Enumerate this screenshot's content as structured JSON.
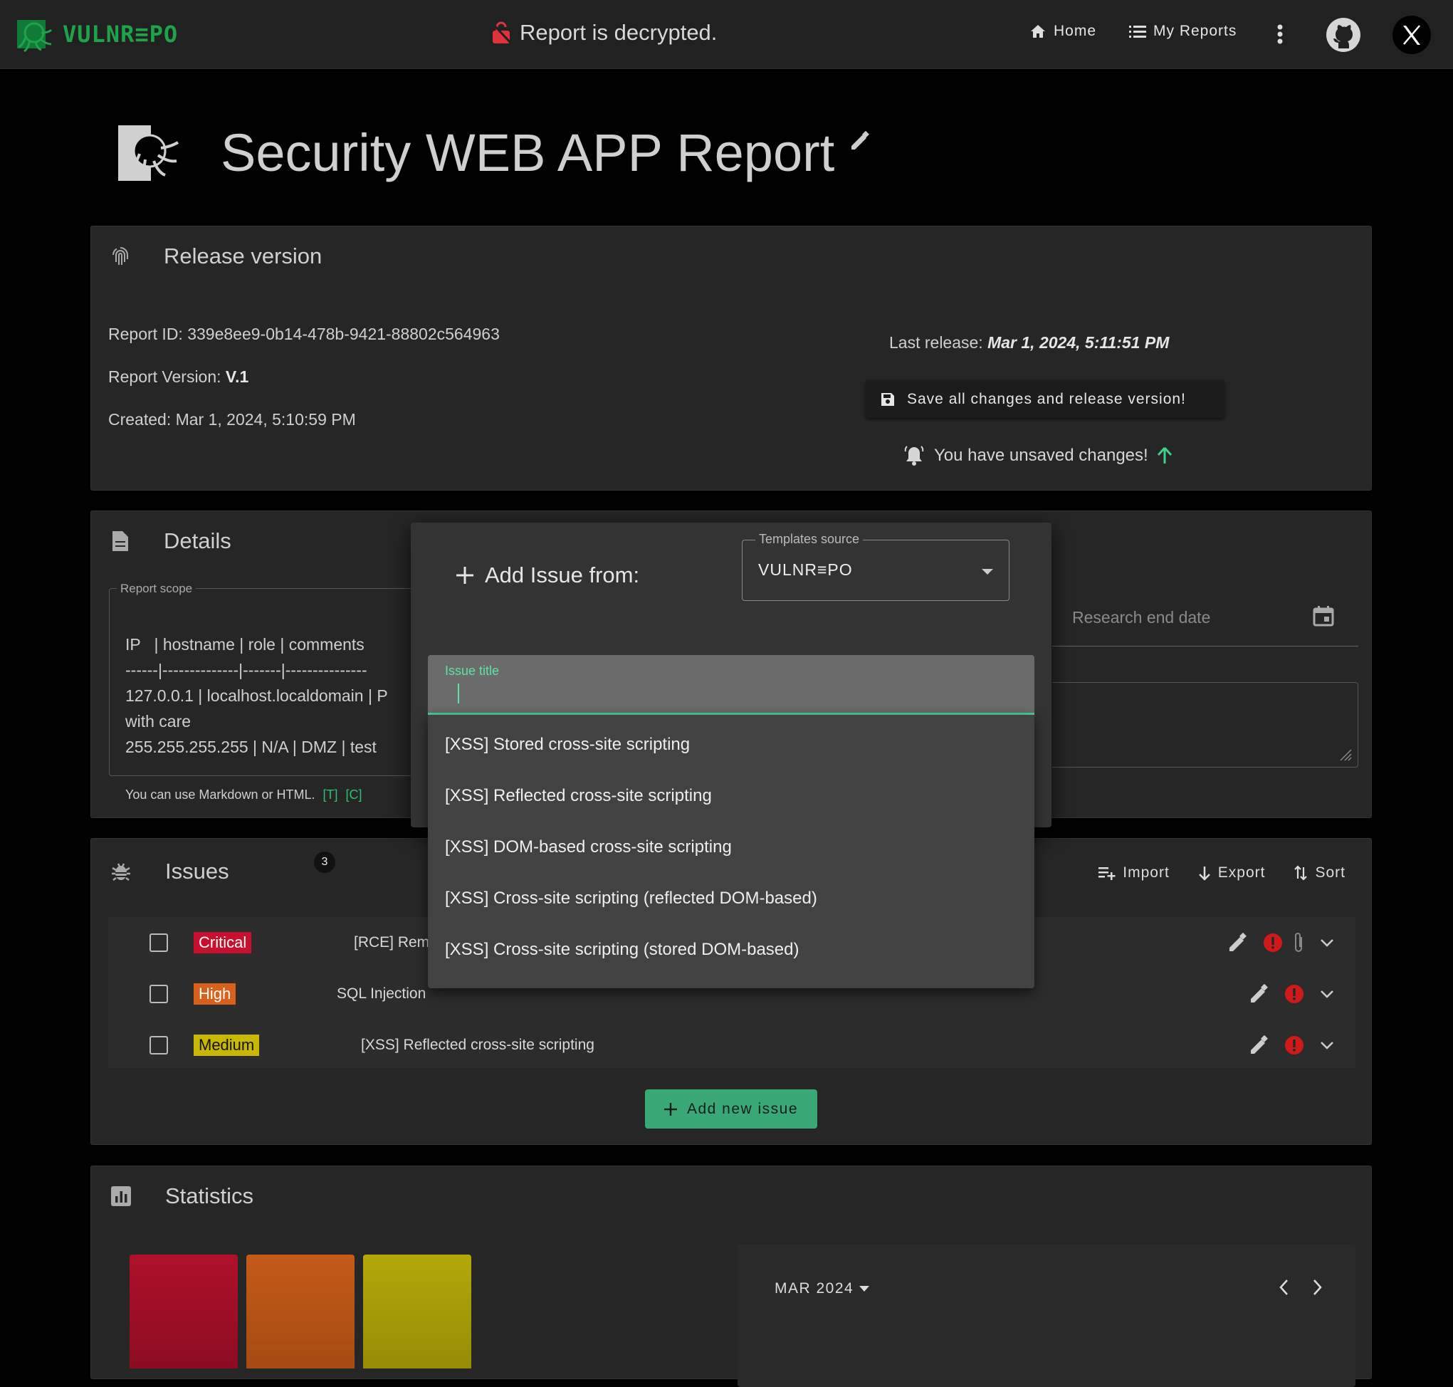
{
  "topbar": {
    "brand": "VULNR≡PO",
    "status": "Report is decrypted.",
    "nav": {
      "home": "Home",
      "reports": "My Reports"
    }
  },
  "page": {
    "title": "Security WEB APP Report"
  },
  "release": {
    "title": "Release version",
    "report_id_label": "Report ID:",
    "report_id": "339e8ee9-0b14-478b-9421-88802c564963",
    "version_label": "Report Version:",
    "version": "V.1",
    "created_label": "Created:",
    "created": "Mar 1, 2024, 5:10:59 PM",
    "last_release_label": "Last release:",
    "last_release": "Mar 1, 2024, 5:11:51 PM",
    "save_label": "Save all changes and release version!",
    "unsaved": "You have unsaved changes!"
  },
  "details": {
    "title": "Details",
    "scope_label": "Report scope",
    "scope_lines": [
      "IP   | hostname | role | comments",
      "------|--------------|-------|---------------",
      "127.0.0.1 | localhost.localdomain | P",
      "with care",
      "255.255.255.255 | N/A | DMZ | test"
    ],
    "helper": "You can use Markdown or HTML.",
    "helper_links": [
      "[T]",
      "[C]"
    ],
    "end_date_placeholder": "Research end date"
  },
  "issues": {
    "title": "Issues",
    "count": "3",
    "actions": {
      "import": "Import",
      "export": "Export",
      "sort": "Sort"
    },
    "rows": [
      {
        "severity": "Critical",
        "title": "[RCE] Remote Code Exe",
        "color": "#c8102e"
      },
      {
        "severity": "High",
        "title": "SQL Injection",
        "color": "#d9601a"
      },
      {
        "severity": "Medium",
        "title": "[XSS] Reflected cross-site scripting",
        "color": "#c9b800"
      }
    ],
    "add_label": "Add new issue"
  },
  "statistics": {
    "title": "Statistics",
    "bar_colors": [
      "#b0102a",
      "#c45a18",
      "#b3a80a"
    ],
    "calendar_month": "MAR 2024"
  },
  "modal": {
    "title": "Add Issue from:",
    "templates_label": "Templates source",
    "templates_value": "VULNR≡PO",
    "input_label": "Issue title",
    "input_value": "",
    "options": [
      "[XSS] Stored cross-site scripting",
      "[XSS] Reflected cross-site scripting",
      "[XSS] DOM-based cross-site scripting",
      "[XSS] Cross-site scripting (reflected DOM-based)",
      "[XSS] Cross-site scripting (stored DOM-based)"
    ]
  },
  "colors": {
    "accent": "#3aa876",
    "brand": "#1fa34a",
    "error": "#d01a1a"
  }
}
